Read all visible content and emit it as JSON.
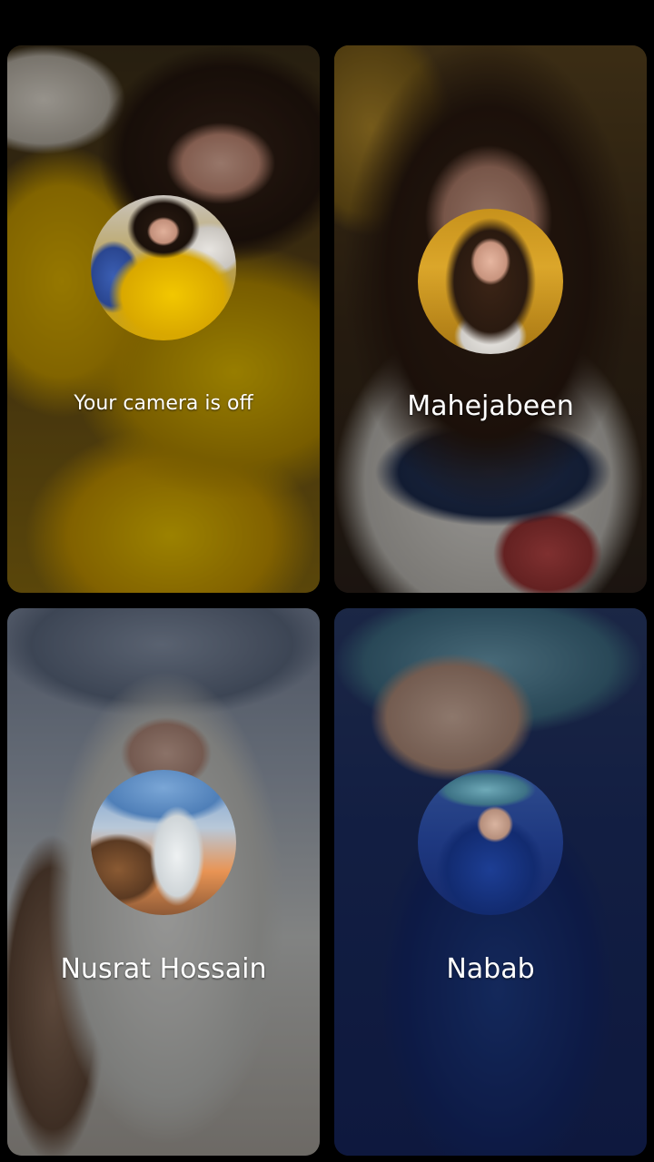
{
  "tiles": [
    {
      "label": "Your camera is off",
      "avatar": "participant-avatar"
    },
    {
      "label": "Mahejabeen",
      "avatar": "participant-avatar"
    },
    {
      "label": "Nusrat Hossain",
      "avatar": "participant-avatar"
    },
    {
      "label": "Nabab",
      "avatar": "participant-avatar"
    }
  ],
  "colors": {
    "background": "#000000",
    "label_text": "#ffffff"
  }
}
